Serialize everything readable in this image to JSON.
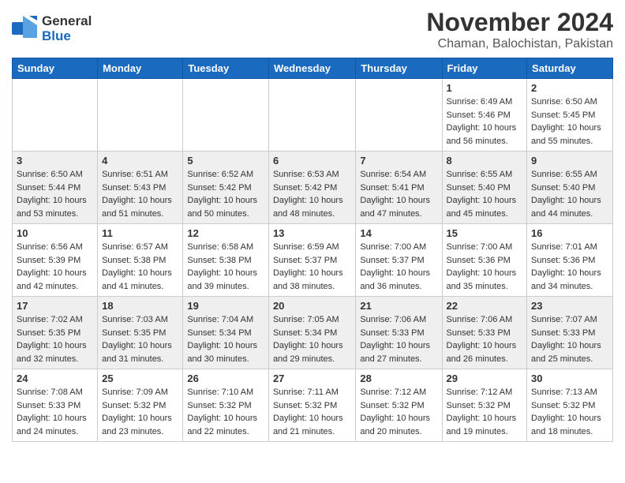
{
  "header": {
    "logo_general": "General",
    "logo_blue": "Blue",
    "month_title": "November 2024",
    "location": "Chaman, Balochistan, Pakistan"
  },
  "weekdays": [
    "Sunday",
    "Monday",
    "Tuesday",
    "Wednesday",
    "Thursday",
    "Friday",
    "Saturday"
  ],
  "weeks": [
    [
      {
        "day": "",
        "info": ""
      },
      {
        "day": "",
        "info": ""
      },
      {
        "day": "",
        "info": ""
      },
      {
        "day": "",
        "info": ""
      },
      {
        "day": "",
        "info": ""
      },
      {
        "day": "1",
        "info": "Sunrise: 6:49 AM\nSunset: 5:46 PM\nDaylight: 10 hours and 56 minutes."
      },
      {
        "day": "2",
        "info": "Sunrise: 6:50 AM\nSunset: 5:45 PM\nDaylight: 10 hours and 55 minutes."
      }
    ],
    [
      {
        "day": "3",
        "info": "Sunrise: 6:50 AM\nSunset: 5:44 PM\nDaylight: 10 hours and 53 minutes."
      },
      {
        "day": "4",
        "info": "Sunrise: 6:51 AM\nSunset: 5:43 PM\nDaylight: 10 hours and 51 minutes."
      },
      {
        "day": "5",
        "info": "Sunrise: 6:52 AM\nSunset: 5:42 PM\nDaylight: 10 hours and 50 minutes."
      },
      {
        "day": "6",
        "info": "Sunrise: 6:53 AM\nSunset: 5:42 PM\nDaylight: 10 hours and 48 minutes."
      },
      {
        "day": "7",
        "info": "Sunrise: 6:54 AM\nSunset: 5:41 PM\nDaylight: 10 hours and 47 minutes."
      },
      {
        "day": "8",
        "info": "Sunrise: 6:55 AM\nSunset: 5:40 PM\nDaylight: 10 hours and 45 minutes."
      },
      {
        "day": "9",
        "info": "Sunrise: 6:55 AM\nSunset: 5:40 PM\nDaylight: 10 hours and 44 minutes."
      }
    ],
    [
      {
        "day": "10",
        "info": "Sunrise: 6:56 AM\nSunset: 5:39 PM\nDaylight: 10 hours and 42 minutes."
      },
      {
        "day": "11",
        "info": "Sunrise: 6:57 AM\nSunset: 5:38 PM\nDaylight: 10 hours and 41 minutes."
      },
      {
        "day": "12",
        "info": "Sunrise: 6:58 AM\nSunset: 5:38 PM\nDaylight: 10 hours and 39 minutes."
      },
      {
        "day": "13",
        "info": "Sunrise: 6:59 AM\nSunset: 5:37 PM\nDaylight: 10 hours and 38 minutes."
      },
      {
        "day": "14",
        "info": "Sunrise: 7:00 AM\nSunset: 5:37 PM\nDaylight: 10 hours and 36 minutes."
      },
      {
        "day": "15",
        "info": "Sunrise: 7:00 AM\nSunset: 5:36 PM\nDaylight: 10 hours and 35 minutes."
      },
      {
        "day": "16",
        "info": "Sunrise: 7:01 AM\nSunset: 5:36 PM\nDaylight: 10 hours and 34 minutes."
      }
    ],
    [
      {
        "day": "17",
        "info": "Sunrise: 7:02 AM\nSunset: 5:35 PM\nDaylight: 10 hours and 32 minutes."
      },
      {
        "day": "18",
        "info": "Sunrise: 7:03 AM\nSunset: 5:35 PM\nDaylight: 10 hours and 31 minutes."
      },
      {
        "day": "19",
        "info": "Sunrise: 7:04 AM\nSunset: 5:34 PM\nDaylight: 10 hours and 30 minutes."
      },
      {
        "day": "20",
        "info": "Sunrise: 7:05 AM\nSunset: 5:34 PM\nDaylight: 10 hours and 29 minutes."
      },
      {
        "day": "21",
        "info": "Sunrise: 7:06 AM\nSunset: 5:33 PM\nDaylight: 10 hours and 27 minutes."
      },
      {
        "day": "22",
        "info": "Sunrise: 7:06 AM\nSunset: 5:33 PM\nDaylight: 10 hours and 26 minutes."
      },
      {
        "day": "23",
        "info": "Sunrise: 7:07 AM\nSunset: 5:33 PM\nDaylight: 10 hours and 25 minutes."
      }
    ],
    [
      {
        "day": "24",
        "info": "Sunrise: 7:08 AM\nSunset: 5:33 PM\nDaylight: 10 hours and 24 minutes."
      },
      {
        "day": "25",
        "info": "Sunrise: 7:09 AM\nSunset: 5:32 PM\nDaylight: 10 hours and 23 minutes."
      },
      {
        "day": "26",
        "info": "Sunrise: 7:10 AM\nSunset: 5:32 PM\nDaylight: 10 hours and 22 minutes."
      },
      {
        "day": "27",
        "info": "Sunrise: 7:11 AM\nSunset: 5:32 PM\nDaylight: 10 hours and 21 minutes."
      },
      {
        "day": "28",
        "info": "Sunrise: 7:12 AM\nSunset: 5:32 PM\nDaylight: 10 hours and 20 minutes."
      },
      {
        "day": "29",
        "info": "Sunrise: 7:12 AM\nSunset: 5:32 PM\nDaylight: 10 hours and 19 minutes."
      },
      {
        "day": "30",
        "info": "Sunrise: 7:13 AM\nSunset: 5:32 PM\nDaylight: 10 hours and 18 minutes."
      }
    ]
  ]
}
